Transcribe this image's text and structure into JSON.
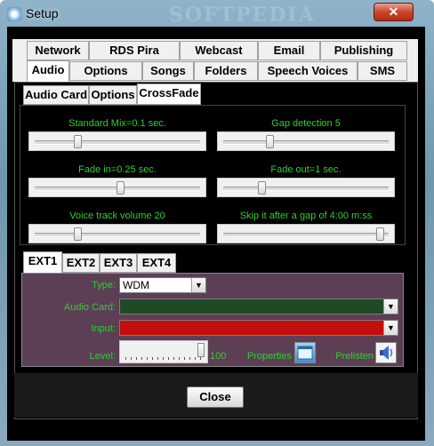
{
  "window": {
    "title": "Setup",
    "watermark": "SOFTPEDIA",
    "close_glyph": "✕"
  },
  "tabs_row1": [
    "Network",
    "RDS Pira",
    "Webcast",
    "Email",
    "Publishing"
  ],
  "tabs_row2": [
    "Audio",
    "Options",
    "Songs",
    "Folders",
    "Speech Voices",
    "SMS"
  ],
  "active_tab": "Audio",
  "subtabs": [
    "Audio Card",
    "Options",
    "CrossFade"
  ],
  "active_subtab": "CrossFade",
  "crossfade": {
    "standard_mix": {
      "label": "Standard Mix=0.1 sec.",
      "level": 0.25
    },
    "gap_detection": {
      "label": "Gap detection 5",
      "level": 0.27
    },
    "fade_in": {
      "label": "Fade in=0.25 sec.",
      "level": 0.52
    },
    "fade_out": {
      "label": "Fade out=1 sec.",
      "level": 0.22
    },
    "voice_track_volume": {
      "label": "Voice track volume 20",
      "level": 0.25
    },
    "skip_gap": {
      "label": "Skip it after a gap of 4:00 m:ss",
      "level": 0.97
    }
  },
  "ext_tabs": [
    "EXT1",
    "EXT2",
    "EXT3",
    "EXT4"
  ],
  "active_ext_tab": "EXT1",
  "ext": {
    "type_label": "Type:",
    "type_value": "WDM",
    "audio_card_label": "Audio Card:",
    "input_label": "Input:",
    "level_label": "Level:",
    "level_value": "100",
    "properties_label": "Properties",
    "prelisten_label": "Prelisten"
  },
  "close_button": "Close",
  "colors": {
    "label_green": "#2fcf2f",
    "ext_panel": "#5c3f55",
    "audio_card_field": "#1f4a26",
    "input_field": "#c40e0e"
  }
}
